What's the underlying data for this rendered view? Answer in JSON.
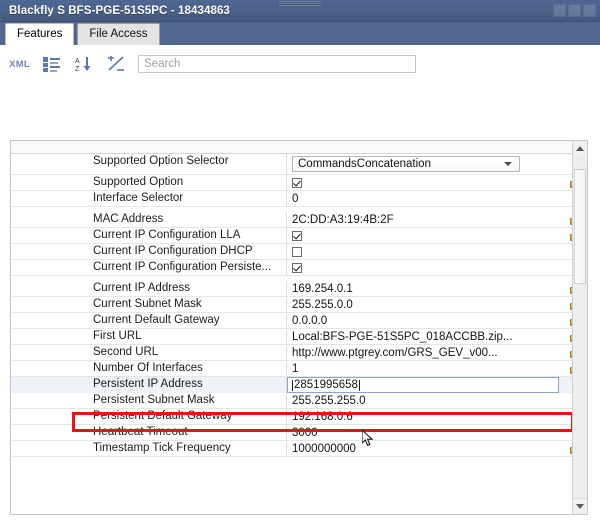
{
  "window": {
    "title": "Blackfly S BFS-PGE-51S5PC - 18434863"
  },
  "tabs": [
    {
      "label": "Features",
      "active": true
    },
    {
      "label": "File Access",
      "active": false
    }
  ],
  "toolbar": {
    "xml_label": "XML",
    "icons": [
      "xml-icon",
      "category-view-icon",
      "sort-alpha-icon",
      "visibility-toggle-icon"
    ],
    "search": {
      "placeholder": "Search",
      "value": ""
    }
  },
  "table": {
    "rows": [
      {
        "name": "Supported Option Selector",
        "value": "CommandsConcatenation",
        "type": "combo",
        "locked": false,
        "gap": false
      },
      {
        "name": "Supported Option",
        "value": "",
        "type": "checkbox",
        "checked": true,
        "locked": true,
        "gap": false
      },
      {
        "name": "Interface Selector",
        "value": "0",
        "type": "text",
        "locked": false,
        "gap": false
      },
      {
        "name": "MAC Address",
        "value": "2C:DD:A3:19:4B:2F",
        "type": "text",
        "locked": true,
        "gap": true
      },
      {
        "name": "Current IP Configuration LLA",
        "value": "",
        "type": "checkbox",
        "checked": true,
        "locked": true,
        "gap": false
      },
      {
        "name": "Current IP Configuration DHCP",
        "value": "",
        "type": "checkbox",
        "checked": false,
        "locked": false,
        "gap": false
      },
      {
        "name": "Current IP Configuration Persiste...",
        "value": "",
        "type": "checkbox",
        "checked": true,
        "locked": false,
        "gap": false
      },
      {
        "name": "Current IP Address",
        "value": "169.254.0.1",
        "type": "text",
        "locked": true,
        "gap": true
      },
      {
        "name": "Current Subnet Mask",
        "value": "255.255.0.0",
        "type": "text",
        "locked": true,
        "gap": false
      },
      {
        "name": "Current Default Gateway",
        "value": "0.0.0.0",
        "type": "text",
        "locked": true,
        "gap": false
      },
      {
        "name": "First URL",
        "value": "Local:BFS-PGE-51S5PC_018ACCBB.zip...",
        "type": "text",
        "locked": true,
        "gap": false
      },
      {
        "name": "Second URL",
        "value": "http://www.ptgrey.com/GRS_GEV_v00...",
        "type": "text",
        "locked": true,
        "gap": false
      },
      {
        "name": "Number Of Interfaces",
        "value": "1",
        "type": "text",
        "locked": true,
        "gap": false
      },
      {
        "name": "Persistent IP Address",
        "value": "2851995658",
        "type": "editing",
        "locked": false,
        "gap": false
      },
      {
        "name": "Persistent Subnet Mask",
        "value": "255.255.255.0",
        "type": "text",
        "locked": false,
        "gap": false
      },
      {
        "name": "Persistent Default Gateway",
        "value": "192.168.0.6",
        "type": "text",
        "locked": false,
        "gap": false
      },
      {
        "name": "Heartbeat Timeout",
        "value": "3000",
        "type": "text",
        "locked": false,
        "gap": false
      },
      {
        "name": "Timestamp Tick Frequency",
        "value": "1000000000",
        "type": "text",
        "locked": true,
        "gap": false
      }
    ]
  },
  "colors": {
    "titlebar": "#4a6189",
    "tabstrip": "#51678f",
    "highlight_border": "#ee1111",
    "lock": "#d2a945",
    "accent_icon": "#6f86ad"
  }
}
